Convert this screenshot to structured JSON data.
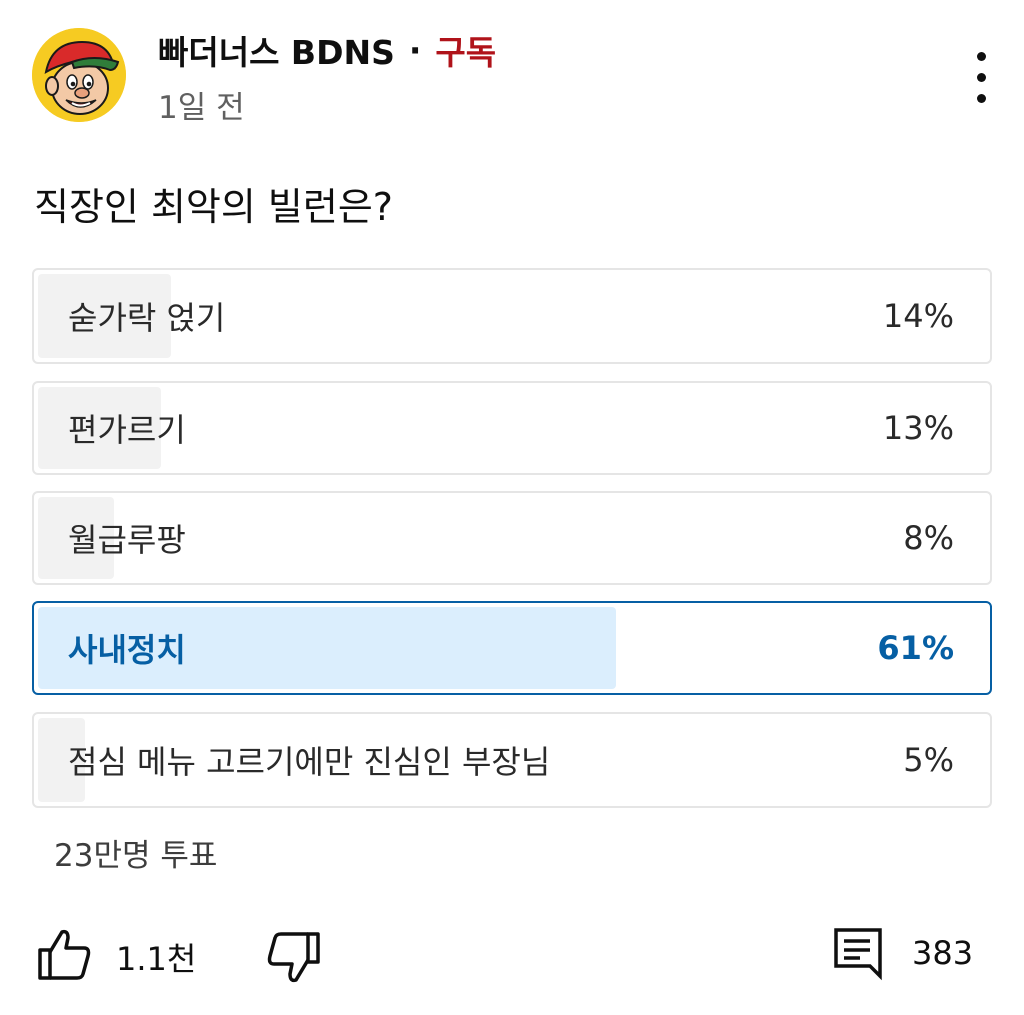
{
  "post": {
    "channel_name": "빠더너스 BDNS",
    "separator": "·",
    "subscribe_label": "구독",
    "time_ago": "1일 전",
    "more_icon": "more-vertical-icon",
    "avatar": "channel-avatar-cartoon-face-red-cap"
  },
  "poll": {
    "question": "직장인 최악의 빌런은?",
    "options": [
      {
        "label": "숟가락 얹기",
        "percent": "14%",
        "value": 14,
        "selected": false
      },
      {
        "label": "편가르기",
        "percent": "13%",
        "value": 13,
        "selected": false
      },
      {
        "label": "월급루팡",
        "percent": "8%",
        "value": 8,
        "selected": false
      },
      {
        "label": "사내정치",
        "percent": "61%",
        "value": 61,
        "selected": true
      },
      {
        "label": "점심 메뉴 고르기에만 진심인 부장님",
        "percent": "5%",
        "value": 5,
        "selected": false
      }
    ],
    "vote_count": "23만명 투표"
  },
  "actions": {
    "like_icon": "thumbs-up-icon",
    "like_count": "1.1천",
    "dislike_icon": "thumbs-down-icon",
    "comment_icon": "comment-icon",
    "comment_count": "383"
  },
  "colors": {
    "subscribe": "#b0131a",
    "selected_accent": "#065fa4",
    "selected_fill": "#dbeefd",
    "unselected_fill": "#f2f2f2",
    "border": "#e5e5e5",
    "avatar_background": "#f6cb22"
  }
}
